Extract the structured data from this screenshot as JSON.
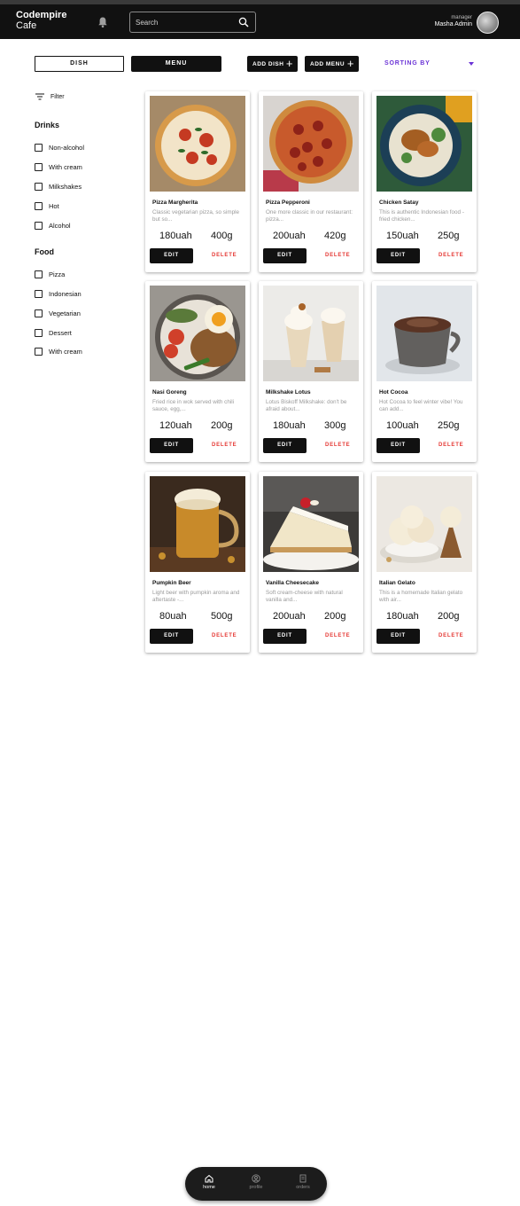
{
  "app": {
    "brand_line1": "Codempire",
    "brand_line2": "Cafe"
  },
  "header": {
    "search_placeholder": "Search",
    "user_role": "manager",
    "user_name": "Masha Admin"
  },
  "toolbar": {
    "dish_label": "DISH",
    "menu_label": "MENU",
    "add_dish_label": "ADD DISH",
    "add_menu_label": "ADD MENU",
    "sorting_label": "SORTING BY"
  },
  "sidebar": {
    "filter_label": "Filter",
    "drinks_title": "Drinks",
    "drinks": [
      "Non-alcohol",
      "With cream",
      "Milkshakes",
      "Hot",
      "Alcohol"
    ],
    "food_title": "Food",
    "food": [
      "Pizza",
      "Indonesian",
      "Vegetarian",
      "Dessert",
      "With cream"
    ]
  },
  "card_actions": {
    "edit_label": "EDIT",
    "delete_label": "DELETE"
  },
  "dishes": [
    {
      "title": "Pizza Margherita",
      "desc": "Classic vegetarian pizza, so simple but so...",
      "price": "180uah",
      "weight": "400g"
    },
    {
      "title": "Pizza Pepperoni",
      "desc": "One more classic in our restaurant: pizza...",
      "price": "200uah",
      "weight": "420g"
    },
    {
      "title": "Chicken Satay",
      "desc": "This is authentic Indonesian food - fried chicken...",
      "price": "150uah",
      "weight": "250g"
    },
    {
      "title": "Nasi Goreng",
      "desc": "Fried rice in wok served with chili sauce, egg,...",
      "price": "120uah",
      "weight": "200g"
    },
    {
      "title": "Milkshake Lotus",
      "desc": "Lotus Biskoff Milkshake: don't be afraid about...",
      "price": "180uah",
      "weight": "300g"
    },
    {
      "title": "Hot Cocoa",
      "desc": "Hot Cocoa to feel winter vibe! You can add...",
      "price": "100uah",
      "weight": "250g"
    },
    {
      "title": "Pumpkin Beer",
      "desc": "Light beer with pumpkin aroma and aftertaste -...",
      "price": "80uah",
      "weight": "500g"
    },
    {
      "title": "Vanilla Cheesecake",
      "desc": "Soft cream-cheese with natural vanilla and...",
      "price": "200uah",
      "weight": "200g"
    },
    {
      "title": "Italian Gelato",
      "desc": "This is a homemade Italian gelato with air...",
      "price": "180uah",
      "weight": "200g"
    }
  ],
  "bottom_nav": {
    "home": "home",
    "profile": "profile",
    "orders": "orders"
  },
  "colors": {
    "header_bg": "#111111",
    "accent_purple": "#6b34d6",
    "delete_red": "#e53935"
  }
}
